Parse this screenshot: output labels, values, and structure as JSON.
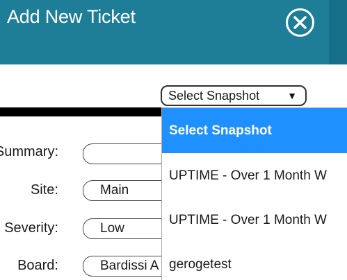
{
  "dialog": {
    "title": "Add New Ticket"
  },
  "snapshot_select": {
    "selected": "Select Snapshot",
    "arrow_icon": "▼",
    "options": [
      "Select Snapshot",
      "UPTIME - Over 1 Month W",
      "UPTIME - Over 1 Month W",
      "gerogetest"
    ]
  },
  "form": {
    "fields": [
      {
        "label": "Summary:",
        "value": ""
      },
      {
        "label": "Site:",
        "value": "Main"
      },
      {
        "label": "Severity:",
        "value": "Low"
      },
      {
        "label": "Board:",
        "value": "Bardissi A"
      }
    ]
  },
  "colors": {
    "header": "#1f7e97",
    "selected_option": "#1e90ff"
  }
}
